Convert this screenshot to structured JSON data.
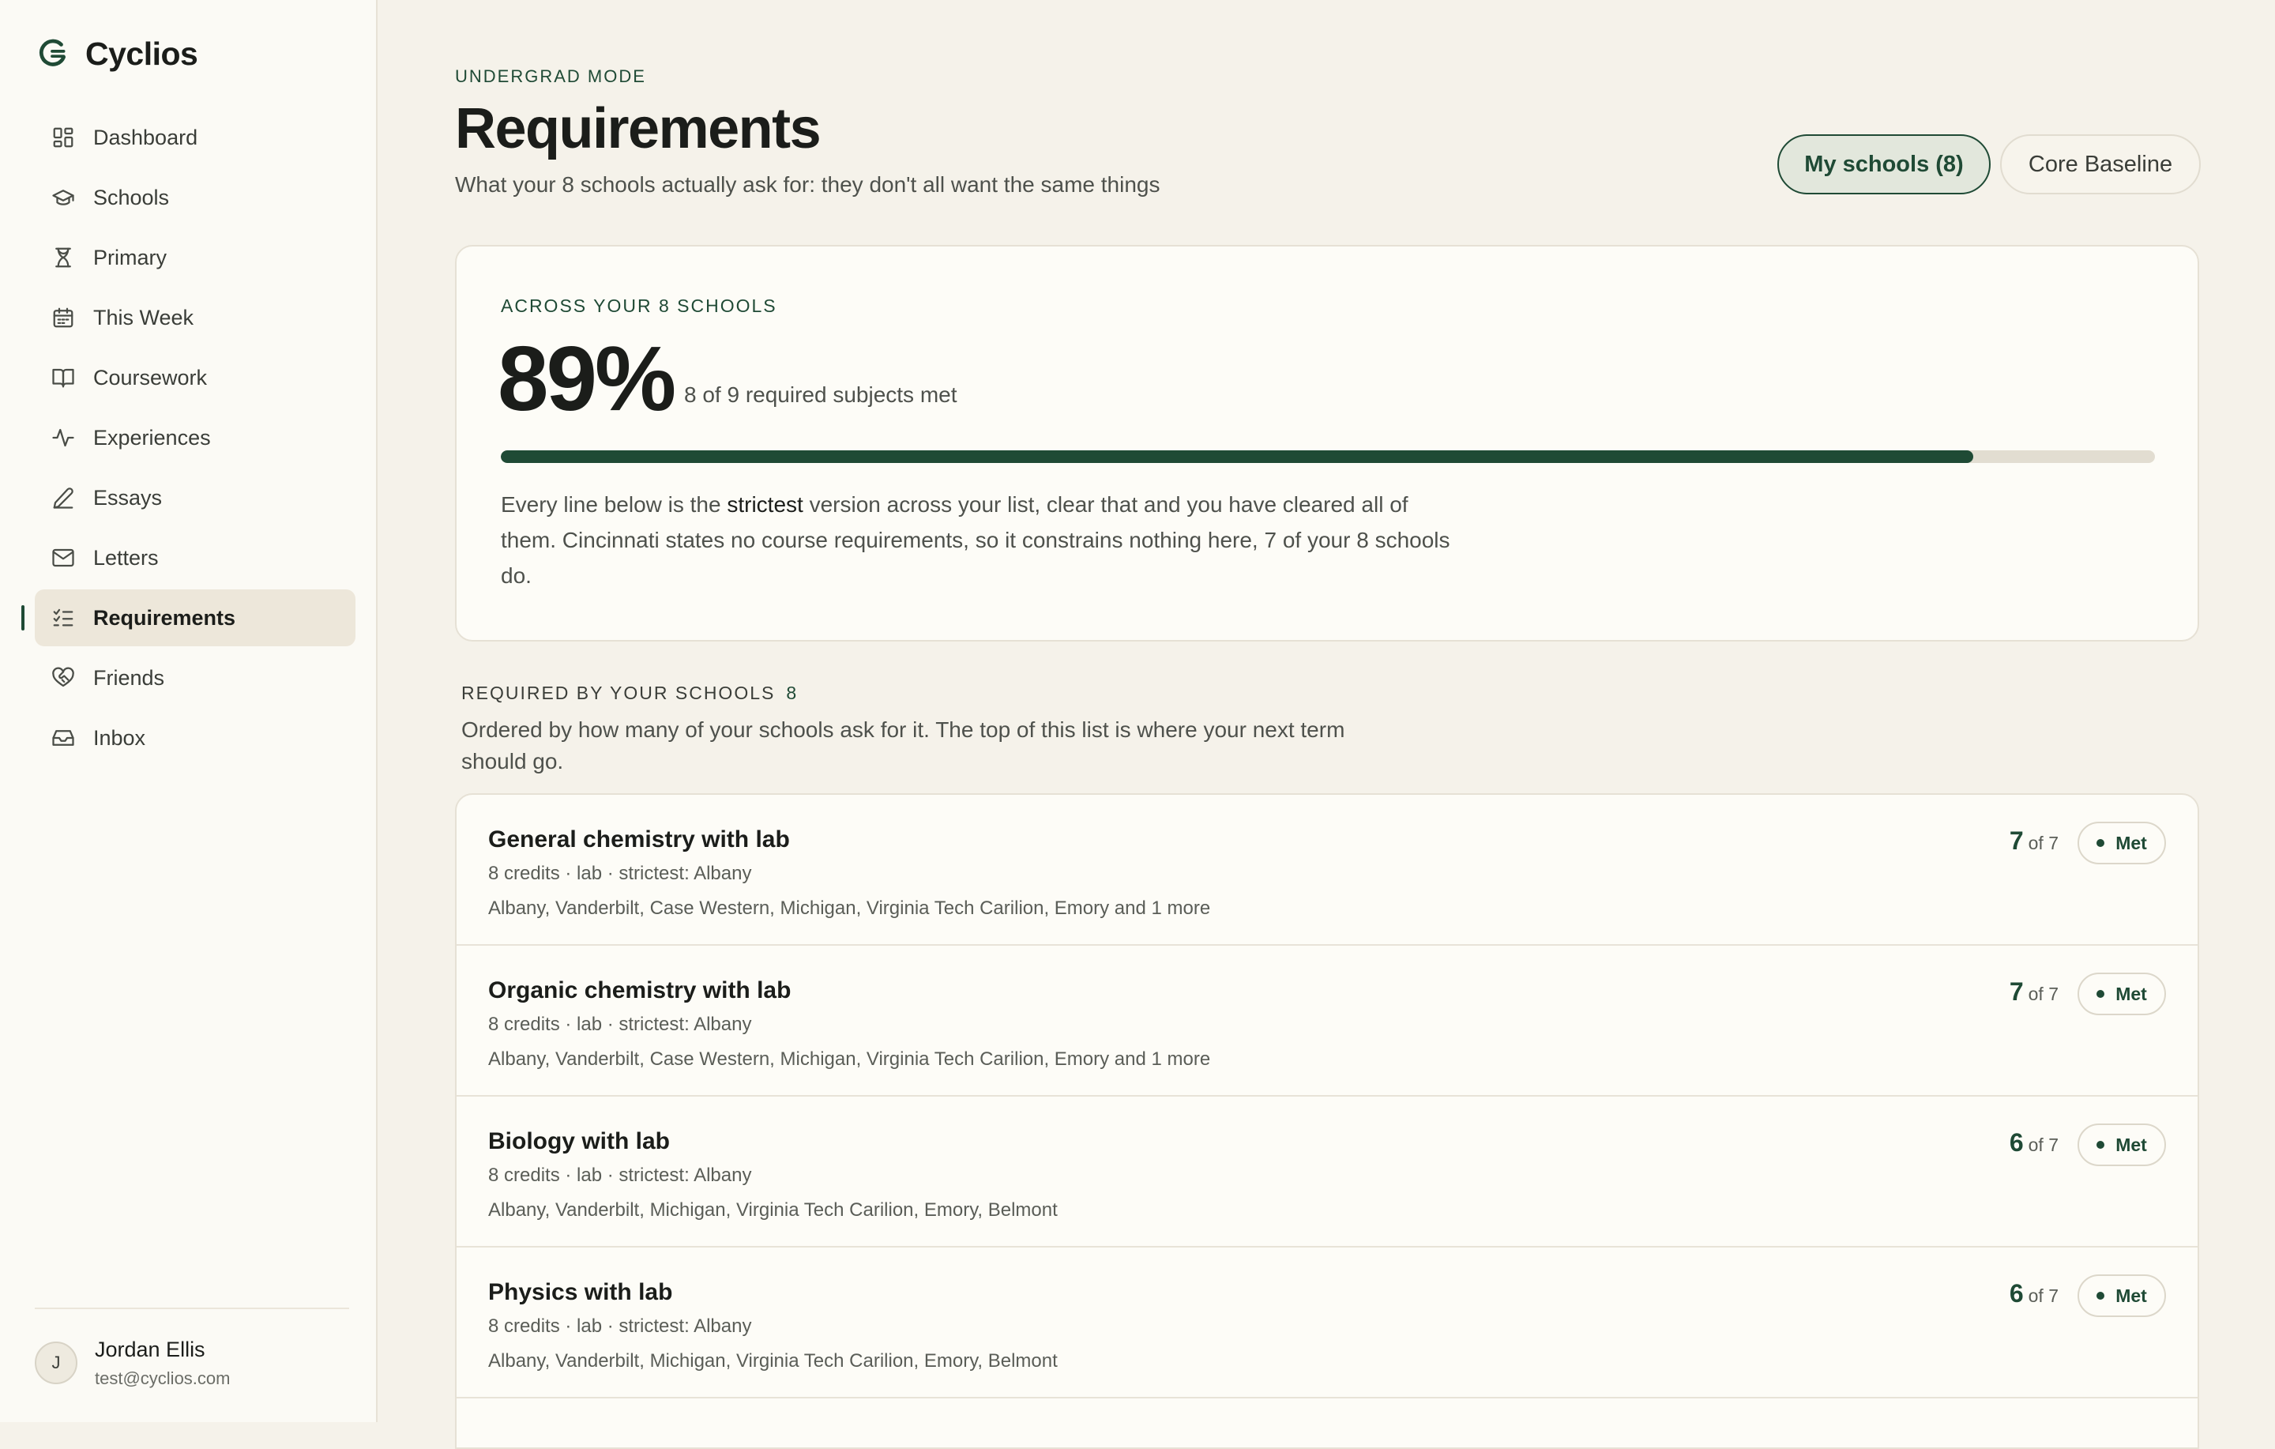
{
  "brand": {
    "name": "Cyclios"
  },
  "nav": [
    {
      "label": "Dashboard",
      "icon": "grid-icon"
    },
    {
      "label": "Schools",
      "icon": "graduation-cap-icon"
    },
    {
      "label": "Primary",
      "icon": "hourglass-icon"
    },
    {
      "label": "This Week",
      "icon": "calendar-icon"
    },
    {
      "label": "Coursework",
      "icon": "book-icon"
    },
    {
      "label": "Experiences",
      "icon": "activity-icon"
    },
    {
      "label": "Essays",
      "icon": "pencil-icon"
    },
    {
      "label": "Letters",
      "icon": "mail-icon"
    },
    {
      "label": "Requirements",
      "icon": "checklist-icon",
      "active": true
    },
    {
      "label": "Friends",
      "icon": "heart-handshake-icon"
    },
    {
      "label": "Inbox",
      "icon": "inbox-icon"
    }
  ],
  "user": {
    "initial": "J",
    "name": "Jordan Ellis",
    "email": "test@cyclios.com"
  },
  "header": {
    "mode": "UNDERGRAD MODE",
    "title": "Requirements",
    "subtitle": "What your 8 schools actually ask for: they don't all want the same things"
  },
  "toggles": {
    "my_schools": "My schools (8)",
    "core_baseline": "Core Baseline"
  },
  "summary": {
    "label": "ACROSS YOUR 8 SCHOOLS",
    "percent": "89%",
    "progress_fraction": 0.89,
    "subtitle": "8 of 9 required subjects met",
    "note_before": "Every line below is the ",
    "note_bold": "strictest",
    "note_after": " version across your list, clear that and you have cleared all of them. Cincinnati states no course requirements, so it constrains nothing here, 7 of your 8 schools do."
  },
  "section": {
    "label": "REQUIRED BY YOUR SCHOOLS",
    "count": "8",
    "description": "Ordered by how many of your schools ask for it. The top of this list is where your next term should go."
  },
  "requirements": [
    {
      "name": "General chemistry with lab",
      "meta": "8 credits · lab · strictest: Albany",
      "schools": "Albany, Vanderbilt, Case Western, Michigan, Virginia Tech Carilion, Emory and 1 more",
      "count": "7",
      "of": "of 7",
      "status": "Met"
    },
    {
      "name": "Organic chemistry with lab",
      "meta": "8 credits · lab · strictest: Albany",
      "schools": "Albany, Vanderbilt, Case Western, Michigan, Virginia Tech Carilion, Emory and 1 more",
      "count": "7",
      "of": "of 7",
      "status": "Met"
    },
    {
      "name": "Biology with lab",
      "meta": "8 credits · lab · strictest: Albany",
      "schools": "Albany, Vanderbilt, Michigan, Virginia Tech Carilion, Emory, Belmont",
      "count": "6",
      "of": "of 7",
      "status": "Met"
    },
    {
      "name": "Physics with lab",
      "meta": "8 credits · lab · strictest: Albany",
      "schools": "Albany, Vanderbilt, Michigan, Virginia Tech Carilion, Emory, Belmont",
      "count": "6",
      "of": "of 7",
      "status": "Met"
    }
  ],
  "colors": {
    "accent": "#1f4a35",
    "background": "#f5f2ea",
    "sidebar": "#fbfaf5",
    "card": "#fdfcf7"
  }
}
